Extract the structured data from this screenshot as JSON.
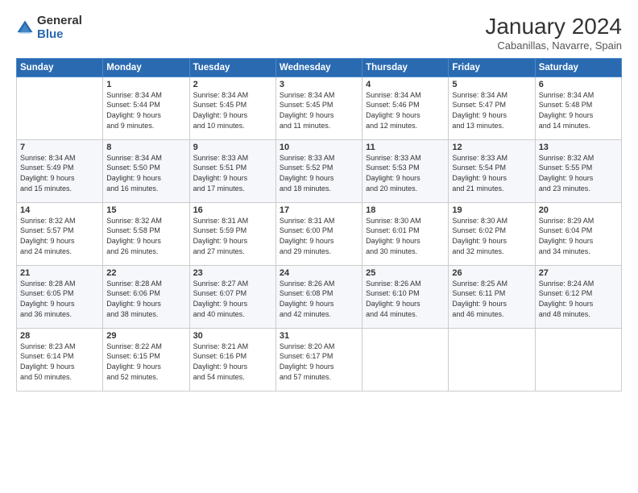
{
  "logo": {
    "general": "General",
    "blue": "Blue"
  },
  "title": "January 2024",
  "location": "Cabanillas, Navarre, Spain",
  "days_header": [
    "Sunday",
    "Monday",
    "Tuesday",
    "Wednesday",
    "Thursday",
    "Friday",
    "Saturday"
  ],
  "weeks": [
    [
      {
        "day": "",
        "info": ""
      },
      {
        "day": "1",
        "info": "Sunrise: 8:34 AM\nSunset: 5:44 PM\nDaylight: 9 hours\nand 9 minutes."
      },
      {
        "day": "2",
        "info": "Sunrise: 8:34 AM\nSunset: 5:45 PM\nDaylight: 9 hours\nand 10 minutes."
      },
      {
        "day": "3",
        "info": "Sunrise: 8:34 AM\nSunset: 5:45 PM\nDaylight: 9 hours\nand 11 minutes."
      },
      {
        "day": "4",
        "info": "Sunrise: 8:34 AM\nSunset: 5:46 PM\nDaylight: 9 hours\nand 12 minutes."
      },
      {
        "day": "5",
        "info": "Sunrise: 8:34 AM\nSunset: 5:47 PM\nDaylight: 9 hours\nand 13 minutes."
      },
      {
        "day": "6",
        "info": "Sunrise: 8:34 AM\nSunset: 5:48 PM\nDaylight: 9 hours\nand 14 minutes."
      }
    ],
    [
      {
        "day": "7",
        "info": "Sunrise: 8:34 AM\nSunset: 5:49 PM\nDaylight: 9 hours\nand 15 minutes."
      },
      {
        "day": "8",
        "info": "Sunrise: 8:34 AM\nSunset: 5:50 PM\nDaylight: 9 hours\nand 16 minutes."
      },
      {
        "day": "9",
        "info": "Sunrise: 8:33 AM\nSunset: 5:51 PM\nDaylight: 9 hours\nand 17 minutes."
      },
      {
        "day": "10",
        "info": "Sunrise: 8:33 AM\nSunset: 5:52 PM\nDaylight: 9 hours\nand 18 minutes."
      },
      {
        "day": "11",
        "info": "Sunrise: 8:33 AM\nSunset: 5:53 PM\nDaylight: 9 hours\nand 20 minutes."
      },
      {
        "day": "12",
        "info": "Sunrise: 8:33 AM\nSunset: 5:54 PM\nDaylight: 9 hours\nand 21 minutes."
      },
      {
        "day": "13",
        "info": "Sunrise: 8:32 AM\nSunset: 5:55 PM\nDaylight: 9 hours\nand 23 minutes."
      }
    ],
    [
      {
        "day": "14",
        "info": "Sunrise: 8:32 AM\nSunset: 5:57 PM\nDaylight: 9 hours\nand 24 minutes."
      },
      {
        "day": "15",
        "info": "Sunrise: 8:32 AM\nSunset: 5:58 PM\nDaylight: 9 hours\nand 26 minutes."
      },
      {
        "day": "16",
        "info": "Sunrise: 8:31 AM\nSunset: 5:59 PM\nDaylight: 9 hours\nand 27 minutes."
      },
      {
        "day": "17",
        "info": "Sunrise: 8:31 AM\nSunset: 6:00 PM\nDaylight: 9 hours\nand 29 minutes."
      },
      {
        "day": "18",
        "info": "Sunrise: 8:30 AM\nSunset: 6:01 PM\nDaylight: 9 hours\nand 30 minutes."
      },
      {
        "day": "19",
        "info": "Sunrise: 8:30 AM\nSunset: 6:02 PM\nDaylight: 9 hours\nand 32 minutes."
      },
      {
        "day": "20",
        "info": "Sunrise: 8:29 AM\nSunset: 6:04 PM\nDaylight: 9 hours\nand 34 minutes."
      }
    ],
    [
      {
        "day": "21",
        "info": "Sunrise: 8:28 AM\nSunset: 6:05 PM\nDaylight: 9 hours\nand 36 minutes."
      },
      {
        "day": "22",
        "info": "Sunrise: 8:28 AM\nSunset: 6:06 PM\nDaylight: 9 hours\nand 38 minutes."
      },
      {
        "day": "23",
        "info": "Sunrise: 8:27 AM\nSunset: 6:07 PM\nDaylight: 9 hours\nand 40 minutes."
      },
      {
        "day": "24",
        "info": "Sunrise: 8:26 AM\nSunset: 6:08 PM\nDaylight: 9 hours\nand 42 minutes."
      },
      {
        "day": "25",
        "info": "Sunrise: 8:26 AM\nSunset: 6:10 PM\nDaylight: 9 hours\nand 44 minutes."
      },
      {
        "day": "26",
        "info": "Sunrise: 8:25 AM\nSunset: 6:11 PM\nDaylight: 9 hours\nand 46 minutes."
      },
      {
        "day": "27",
        "info": "Sunrise: 8:24 AM\nSunset: 6:12 PM\nDaylight: 9 hours\nand 48 minutes."
      }
    ],
    [
      {
        "day": "28",
        "info": "Sunrise: 8:23 AM\nSunset: 6:14 PM\nDaylight: 9 hours\nand 50 minutes."
      },
      {
        "day": "29",
        "info": "Sunrise: 8:22 AM\nSunset: 6:15 PM\nDaylight: 9 hours\nand 52 minutes."
      },
      {
        "day": "30",
        "info": "Sunrise: 8:21 AM\nSunset: 6:16 PM\nDaylight: 9 hours\nand 54 minutes."
      },
      {
        "day": "31",
        "info": "Sunrise: 8:20 AM\nSunset: 6:17 PM\nDaylight: 9 hours\nand 57 minutes."
      },
      {
        "day": "",
        "info": ""
      },
      {
        "day": "",
        "info": ""
      },
      {
        "day": "",
        "info": ""
      }
    ]
  ]
}
